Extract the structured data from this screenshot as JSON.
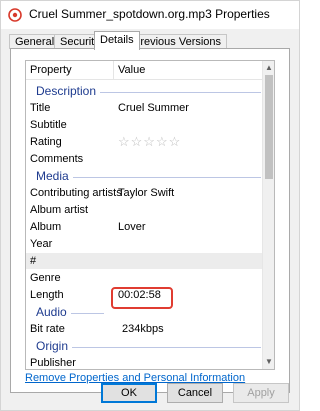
{
  "window": {
    "title": "Cruel Summer_spotdown.org.mp3 Properties"
  },
  "tabs": [
    {
      "label": "General"
    },
    {
      "label": "Security"
    },
    {
      "label": "Details"
    },
    {
      "label": "Previous Versions"
    }
  ],
  "active_tab": "Details",
  "list": {
    "header": {
      "property": "Property",
      "value": "Value"
    },
    "groups": {
      "description": "Description",
      "media": "Media",
      "audio": "Audio",
      "origin": "Origin"
    },
    "rows": {
      "title": {
        "property": "Title",
        "value": "Cruel Summer"
      },
      "subtitle": {
        "property": "Subtitle",
        "value": ""
      },
      "rating": {
        "property": "Rating",
        "stars": "☆☆☆☆☆"
      },
      "comments": {
        "property": "Comments",
        "value": ""
      },
      "contributing_artists": {
        "property": "Contributing artists",
        "value": "Taylor Swift"
      },
      "album_artist": {
        "property": "Album artist",
        "value": ""
      },
      "album": {
        "property": "Album",
        "value": "Lover"
      },
      "year": {
        "property": "Year",
        "value": ""
      },
      "track": {
        "property": "#",
        "value": ""
      },
      "genre": {
        "property": "Genre",
        "value": ""
      },
      "length": {
        "property": "Length",
        "value": "00:02:58"
      },
      "bit_rate": {
        "property": "Bit rate",
        "value": "234kbps"
      },
      "publisher": {
        "property": "Publisher",
        "value": ""
      }
    }
  },
  "links": {
    "remove": "Remove Properties and Personal Information"
  },
  "buttons": {
    "ok": "OK",
    "cancel": "Cancel",
    "apply": "Apply"
  },
  "colors": {
    "group_text": "#1e3b8f",
    "link": "#0066cc",
    "highlight": "#e03c31",
    "ok_border": "#0078d7"
  }
}
